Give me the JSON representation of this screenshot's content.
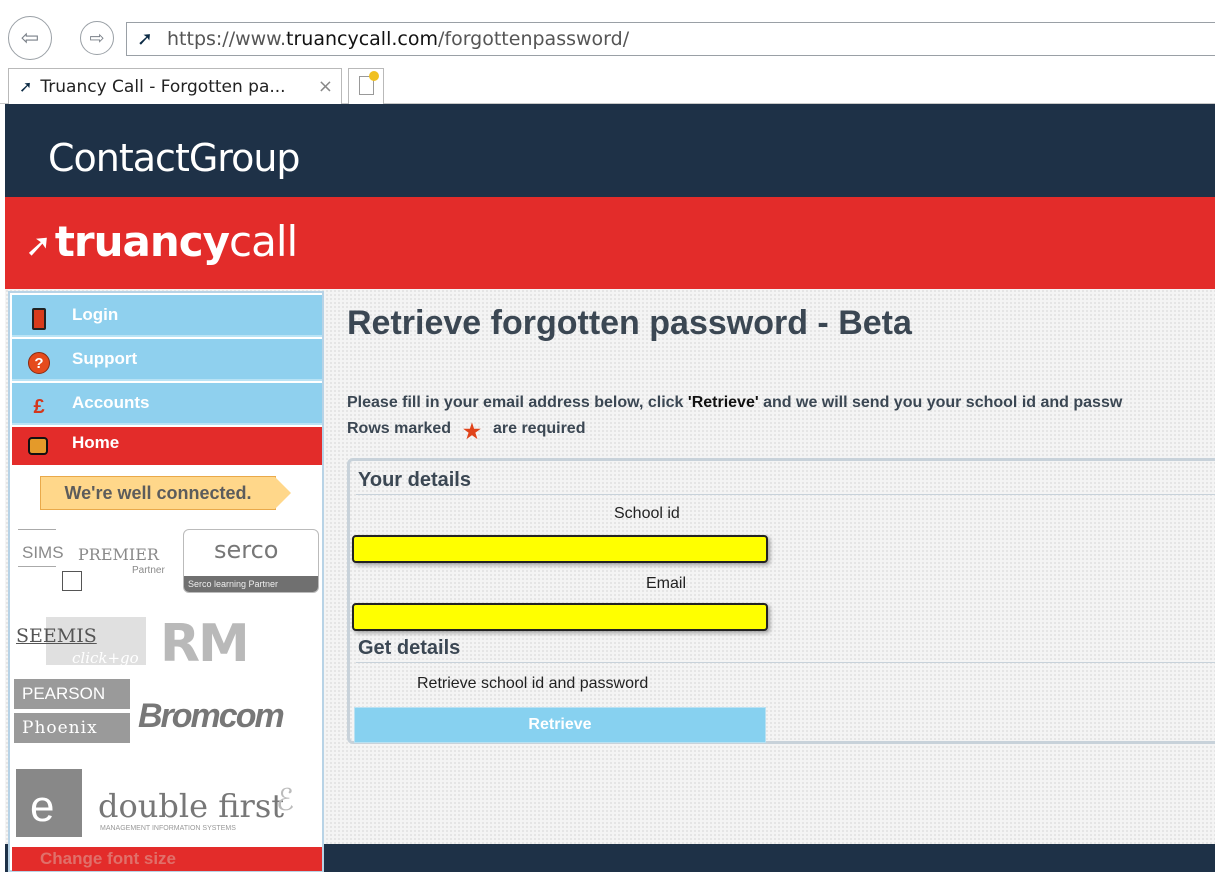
{
  "browser": {
    "url_prefix": "https://www.",
    "url_domain": "truancycall.com",
    "url_path": "/forgottenpassword/",
    "tab_title": "Truancy Call - Forgotten pa...",
    "tab_close": "×",
    "back_glyph": "⇦",
    "forward_glyph": "⇨",
    "site_icon": "truancycall-favicon-icon"
  },
  "header": {
    "brand": "ContactGroup",
    "product_arrow": "➚",
    "product_bold": "truancy",
    "product_light": "call"
  },
  "sidebar": {
    "items": [
      {
        "label": "Login",
        "icon": "door-icon"
      },
      {
        "label": "Support",
        "icon": "question-icon"
      },
      {
        "label": "Accounts",
        "icon": "accounts-icon"
      },
      {
        "label": "Home",
        "icon": "home-icon"
      }
    ],
    "banner": "We're well connected.",
    "partners": {
      "sims_1": "SIMS",
      "sims_2": "PREMIER",
      "sims_3": "Partner",
      "serco": "serco",
      "serco_bar": "Serco learning Partner",
      "seemis_1": "SEEMIS",
      "seemis_2": "click+go",
      "rm": "RM",
      "pearson_1": "PEARSON",
      "pearson_2": "Phoenix",
      "bromcom": "Bromcom",
      "df_e": "e",
      "df_1": "double first",
      "df_2": "MANAGEMENT INFORMATION SYSTEMS"
    },
    "font_size_label": "Change font size"
  },
  "main": {
    "title": "Retrieve forgotten password - Beta",
    "intro_1": "Please fill in your email address below, click ",
    "intro_q": "'Retrieve'",
    "intro_2": " and we will send you your school id and passw",
    "required_1": "Rows marked",
    "required_star": "★",
    "required_2": "are required",
    "section_details": "Your details",
    "label_school": "School id",
    "label_email": "Email",
    "section_get": "Get details",
    "retrieve_caption": "Retrieve school id and password",
    "retrieve_button": "Retrieve"
  },
  "colors": {
    "navy": "#1e3147",
    "red": "#e32c2a",
    "menu_blue": "#8fd0ee",
    "input_yellow": "#ffff00"
  }
}
